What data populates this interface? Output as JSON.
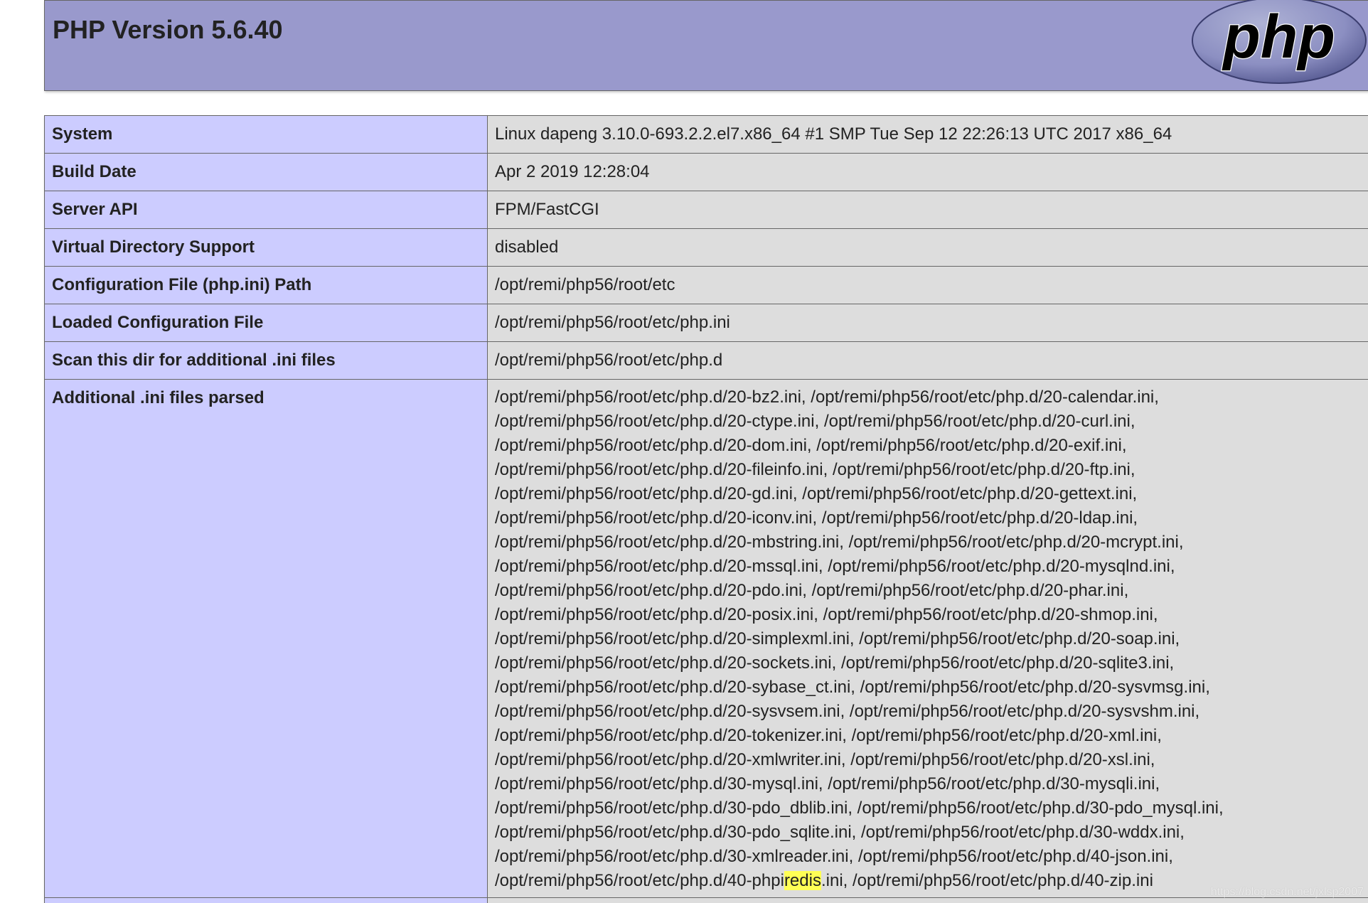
{
  "header": {
    "title": "PHP Version 5.6.40",
    "logo_text": "php"
  },
  "rows": [
    {
      "label": "System",
      "value": "Linux dapeng 3.10.0-693.2.2.el7.x86_64 #1 SMP Tue Sep 12 22:26:13 UTC 2017 x86_64"
    },
    {
      "label": "Build Date",
      "value": "Apr 2 2019 12:28:04"
    },
    {
      "label": "Server API",
      "value": "FPM/FastCGI"
    },
    {
      "label": "Virtual Directory Support",
      "value": "disabled"
    },
    {
      "label": "Configuration File (php.ini) Path",
      "value": "/opt/remi/php56/root/etc"
    },
    {
      "label": "Loaded Configuration File",
      "value": "/opt/remi/php56/root/etc/php.ini"
    },
    {
      "label": "Scan this dir for additional .ini files",
      "value": "/opt/remi/php56/root/etc/php.d"
    }
  ],
  "additional_ini": {
    "label": "Additional .ini files parsed",
    "lines": [
      "/opt/remi/php56/root/etc/php.d/20-bz2.ini, /opt/remi/php56/root/etc/php.d/20-calendar.ini,",
      "/opt/remi/php56/root/etc/php.d/20-ctype.ini, /opt/remi/php56/root/etc/php.d/20-curl.ini,",
      "/opt/remi/php56/root/etc/php.d/20-dom.ini, /opt/remi/php56/root/etc/php.d/20-exif.ini,",
      "/opt/remi/php56/root/etc/php.d/20-fileinfo.ini, /opt/remi/php56/root/etc/php.d/20-ftp.ini,",
      "/opt/remi/php56/root/etc/php.d/20-gd.ini, /opt/remi/php56/root/etc/php.d/20-gettext.ini,",
      "/opt/remi/php56/root/etc/php.d/20-iconv.ini, /opt/remi/php56/root/etc/php.d/20-ldap.ini,",
      "/opt/remi/php56/root/etc/php.d/20-mbstring.ini, /opt/remi/php56/root/etc/php.d/20-mcrypt.ini,",
      "/opt/remi/php56/root/etc/php.d/20-mssql.ini, /opt/remi/php56/root/etc/php.d/20-mysqlnd.ini,",
      "/opt/remi/php56/root/etc/php.d/20-pdo.ini, /opt/remi/php56/root/etc/php.d/20-phar.ini,",
      "/opt/remi/php56/root/etc/php.d/20-posix.ini, /opt/remi/php56/root/etc/php.d/20-shmop.ini,",
      "/opt/remi/php56/root/etc/php.d/20-simplexml.ini, /opt/remi/php56/root/etc/php.d/20-soap.ini,",
      "/opt/remi/php56/root/etc/php.d/20-sockets.ini, /opt/remi/php56/root/etc/php.d/20-sqlite3.ini,",
      "/opt/remi/php56/root/etc/php.d/20-sybase_ct.ini, /opt/remi/php56/root/etc/php.d/20-sysvmsg.ini,",
      "/opt/remi/php56/root/etc/php.d/20-sysvsem.ini, /opt/remi/php56/root/etc/php.d/20-sysvshm.ini,",
      "/opt/remi/php56/root/etc/php.d/20-tokenizer.ini, /opt/remi/php56/root/etc/php.d/20-xml.ini,",
      "/opt/remi/php56/root/etc/php.d/20-xmlwriter.ini, /opt/remi/php56/root/etc/php.d/20-xsl.ini,",
      "/opt/remi/php56/root/etc/php.d/30-mysql.ini, /opt/remi/php56/root/etc/php.d/30-mysqli.ini,",
      "/opt/remi/php56/root/etc/php.d/30-pdo_dblib.ini, /opt/remi/php56/root/etc/php.d/30-pdo_mysql.ini,",
      "/opt/remi/php56/root/etc/php.d/30-pdo_sqlite.ini, /opt/remi/php56/root/etc/php.d/30-wddx.ini,",
      "/opt/remi/php56/root/etc/php.d/30-xmlreader.ini, /opt/remi/php56/root/etc/php.d/40-json.ini,"
    ],
    "last_line": {
      "before": "/opt/remi/php56/root/etc/php.d/40-phpi",
      "highlight": "redis",
      "after": ".ini, /opt/remi/php56/root/etc/php.d/40-zip.ini"
    }
  },
  "watermark": "https://blog.csdn.net/jxlsp2007",
  "colors": {
    "header_bg": "#9999cc",
    "label_bg": "#ccccff",
    "value_bg": "#dddddd",
    "highlight": "#ffff55",
    "border": "#666666"
  }
}
